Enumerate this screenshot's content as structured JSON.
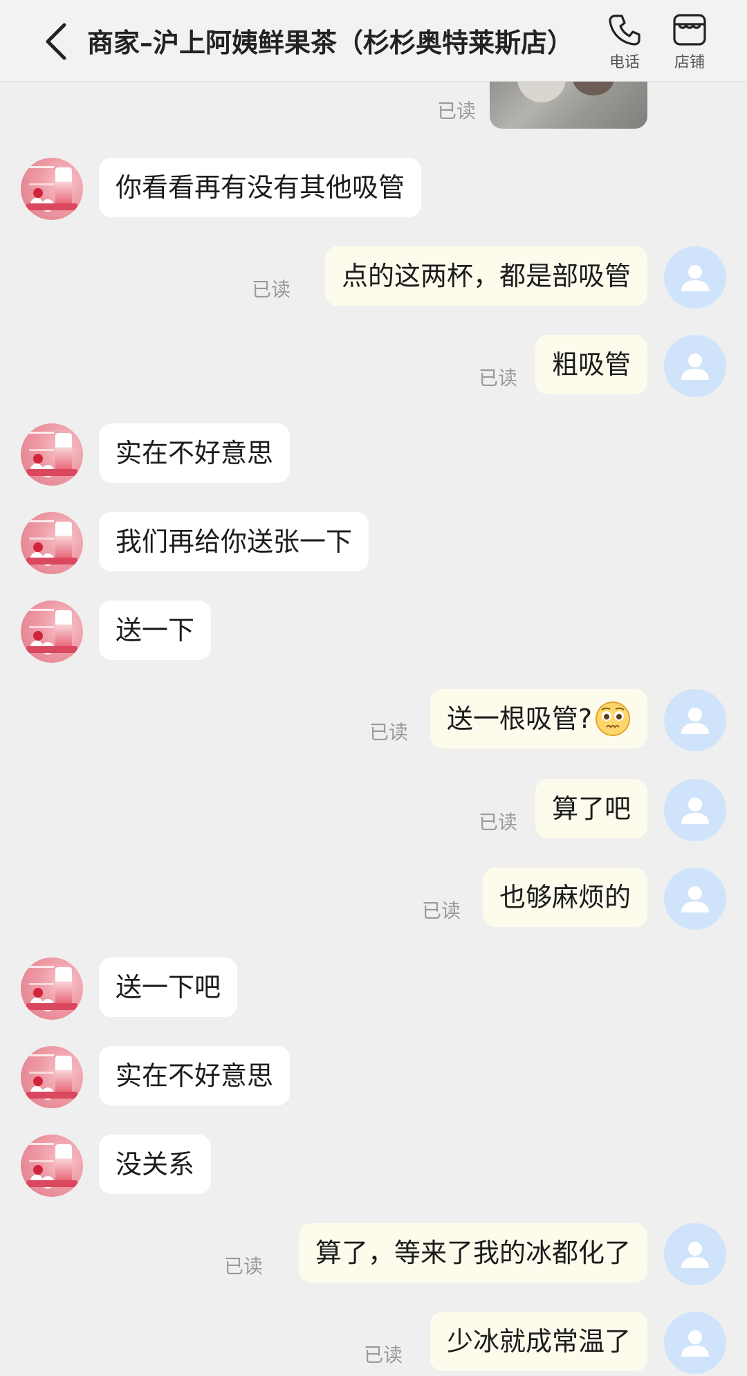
{
  "header": {
    "title": "商家–沪上阿姨鲜果茶（杉杉奥特莱斯店）",
    "phone_label": "电话",
    "store_label": "店铺"
  },
  "colors": {
    "merchant_bubble": "#ffffff",
    "user_bubble": "#fdfbec",
    "user_avatar_bg": "#cfe4fb",
    "user_avatar_glyph": "#ffffff",
    "read_text": "#9a9a9a"
  },
  "icons": {
    "back": "chevron-left-icon",
    "phone": "phone-icon",
    "store": "store-icon",
    "user_avatar": "person-icon",
    "emoji": "pleading-face-emoji-icon"
  },
  "read_label": "已读",
  "messages": [
    {
      "from": "merchant",
      "text": "你看看再有没有其他吸管"
    },
    {
      "from": "user",
      "text": "点的这两杯，都是部吸管",
      "read": true
    },
    {
      "from": "user",
      "text": "粗吸管",
      "read": true
    },
    {
      "from": "merchant",
      "text": "实在不好意思"
    },
    {
      "from": "merchant",
      "text": "我们再给你送张一下"
    },
    {
      "from": "merchant",
      "text": "送一下"
    },
    {
      "from": "user",
      "text": "送一根吸管?",
      "emoji": "pleading-face",
      "read": true
    },
    {
      "from": "user",
      "text": "算了吧",
      "read": true
    },
    {
      "from": "user",
      "text": "也够麻烦的",
      "read": true
    },
    {
      "from": "merchant",
      "text": "送一下吧"
    },
    {
      "from": "merchant",
      "text": "实在不好意思"
    },
    {
      "from": "merchant",
      "text": "没关系"
    },
    {
      "from": "user",
      "text": "算了，等来了我的冰都化了",
      "read": true
    },
    {
      "from": "user",
      "text": "少冰就成常温了",
      "read": true
    }
  ]
}
